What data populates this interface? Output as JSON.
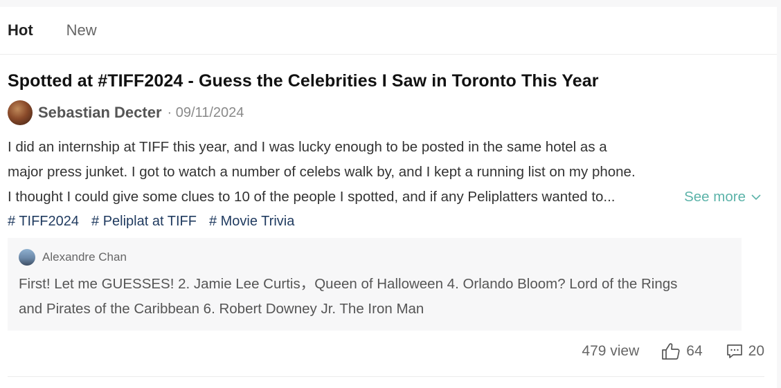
{
  "tabs": [
    {
      "label": "Hot",
      "active": true
    },
    {
      "label": "New",
      "active": false
    }
  ],
  "post": {
    "title": "Spotted at #TIFF2024 - Guess the Celebrities I Saw in Toronto This Year",
    "author": "Sebastian Decter",
    "date": "· 09/11/2024",
    "body_lines": [
      "I did an internship at TIFF this year, and I was lucky enough to be posted in the same hotel as a",
      "major press junket. I got to watch a number of celebs walk by, and I kept a running list on my phone.",
      "I thought I could give some clues to 10 of the people I spotted, and if any Peliplatters wanted to..."
    ],
    "see_more": "See more",
    "tags": [
      "# TIFF2024",
      "# Peliplat at TIFF",
      "# Movie Trivia"
    ]
  },
  "comment": {
    "author": "Alexandre Chan",
    "lines": [
      "First!   Let me GUESSES! 2. Jamie Lee Curtis，Queen of Halloween 4. Orlando Bloom?   Lord of the Rings",
      "and Pirates of the Caribbean 6. Robert Downey Jr. The Iron Man"
    ]
  },
  "stats": {
    "views": "479 view",
    "likes": "64",
    "comments": "20"
  },
  "colors": {
    "accent": "#5cb3a9",
    "tag": "#1f3a5f"
  },
  "icons": {
    "like": "thumbs-up-icon",
    "comment": "comment-icon",
    "see_more": "chevron-down-icon"
  }
}
